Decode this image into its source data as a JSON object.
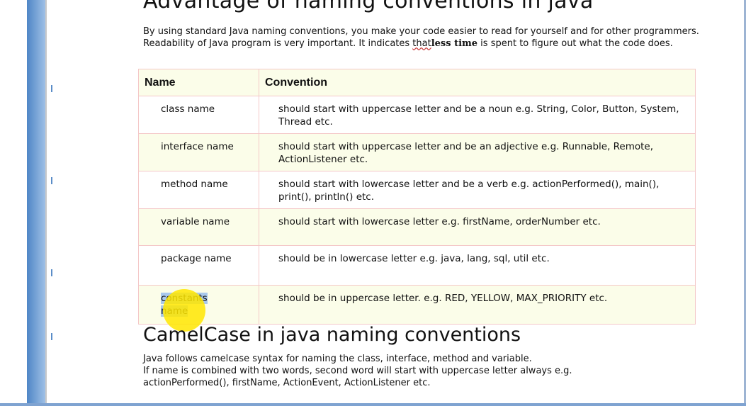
{
  "heading_top": "Advantage of naming conventions in java",
  "intro": {
    "part1": "By using standard Java naming conventions, you make your code easier to read for yourself and for other programmers. Readability of Java program is very important. It indicates ",
    "that": "that",
    "less_time": "less time",
    "part2": " is spent to figure out what the code does."
  },
  "table": {
    "headers": {
      "name": "Name",
      "convention": "Convention"
    },
    "rows": [
      {
        "name": "class name",
        "convention": "should start with uppercase letter and be a noun e.g. String, Color, Button, System, Thread etc."
      },
      {
        "name": "interface name",
        "convention": "should start with uppercase letter and be an adjective e.g. Runnable, Remote, ActionListener etc."
      },
      {
        "name": "method name",
        "convention": "should start with lowercase letter and be a verb e.g. actionPerformed(), main(), print(), println() etc."
      },
      {
        "name": "variable name",
        "convention": "should start with lowercase letter e.g. firstName, orderNumber etc."
      },
      {
        "name": "package name",
        "convention": "should be in lowercase letter e.g. java, lang, sql, util etc."
      },
      {
        "name_selected": "constants",
        "name_rest": "name",
        "convention": "should be in uppercase letter. e.g. RED, YELLOW, MAX_PRIORITY etc."
      }
    ]
  },
  "heading_camel": "CamelCase in java naming conventions",
  "camel": {
    "line1": "Java follows camelcase syntax for naming the class, interface, method and variable.",
    "line2": "If name is combined with two words, second word will start with uppercase letter always e.g.",
    "line3": "actionPerformed(), firstName, ActionEvent, ActionListener etc."
  },
  "colors": {
    "ruler": "#4f86c6",
    "row_highlight": "#fbfde9",
    "table_border": "#f4c8c8",
    "selection": "#a8c8ec",
    "cursor": "#ffe600"
  }
}
